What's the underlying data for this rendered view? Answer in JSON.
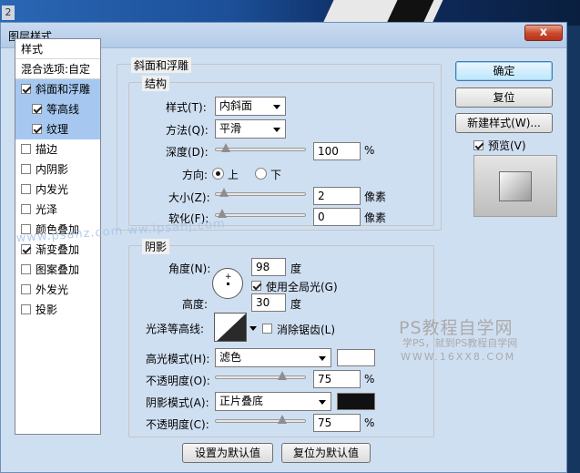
{
  "window": {
    "title": "图层样式",
    "close_label": "x",
    "corner_tag": "2"
  },
  "stylelist": {
    "header": "样式",
    "blend": "混合选项:自定",
    "items": [
      {
        "label": "斜面和浮雕",
        "checked": true
      },
      {
        "label": "等高线",
        "checked": true
      },
      {
        "label": "纹理",
        "checked": true
      },
      {
        "label": "描边",
        "checked": false
      },
      {
        "label": "内阴影",
        "checked": false
      },
      {
        "label": "内发光",
        "checked": false
      },
      {
        "label": "光泽",
        "checked": false
      },
      {
        "label": "颜色叠加",
        "checked": false
      },
      {
        "label": "渐变叠加",
        "checked": true
      },
      {
        "label": "图案叠加",
        "checked": false
      },
      {
        "label": "外发光",
        "checked": false
      },
      {
        "label": "投影",
        "checked": false
      }
    ]
  },
  "bevel": {
    "group_title": "斜面和浮雕",
    "structure_title": "结构",
    "style_label": "样式(T):",
    "style_value": "内斜面",
    "technique_label": "方法(Q):",
    "technique_value": "平滑",
    "depth_label": "深度(D):",
    "depth_value": "100",
    "depth_level": 0.05,
    "percent": "%",
    "direction_label": "方向:",
    "dir_up": "上",
    "dir_down": "下",
    "size_label": "大小(Z):",
    "size_value": "2",
    "size_level": 0.02,
    "soften_label": "软化(F):",
    "soften_value": "0",
    "soften_level": 0.0,
    "px": "像素"
  },
  "shading": {
    "title": "阴影",
    "angle_label": "角度(N):",
    "angle_value": "98",
    "degree": "度",
    "global_light_label": "使用全局光(G)",
    "global_light_checked": true,
    "altitude_label": "高度:",
    "altitude_value": "30",
    "gloss_label": "光泽等高线:",
    "antialias_label": "消除锯齿(L)",
    "antialias_checked": false,
    "highlight_label": "高光模式(H):",
    "highlight_mode": "滤色",
    "highlight_color": "#ffffff",
    "hl_opacity_label": "不透明度(O):",
    "hl_opacity_value": "75",
    "hl_opacity_level": 0.75,
    "shadow_label": "阴影模式(A):",
    "shadow_mode": "正片叠底",
    "shadow_color": "#111111",
    "sh_opacity_label": "不透明度(C):",
    "sh_opacity_value": "75",
    "sh_opacity_level": 0.75
  },
  "bottom": {
    "make_default": "设置为默认值",
    "reset_default": "复位为默认值"
  },
  "right": {
    "ok": "确定",
    "reset": "复位",
    "new_style": "新建样式(W)...",
    "preview_label": "预览(V)",
    "preview_checked": true
  },
  "watermark": {
    "brand": "PS教程自学网",
    "tagline": "学PS，就到PS教程自学网",
    "url": "WWW.16XX8.COM",
    "diag": "www.psahz.com  ww.ipsahj.com"
  }
}
